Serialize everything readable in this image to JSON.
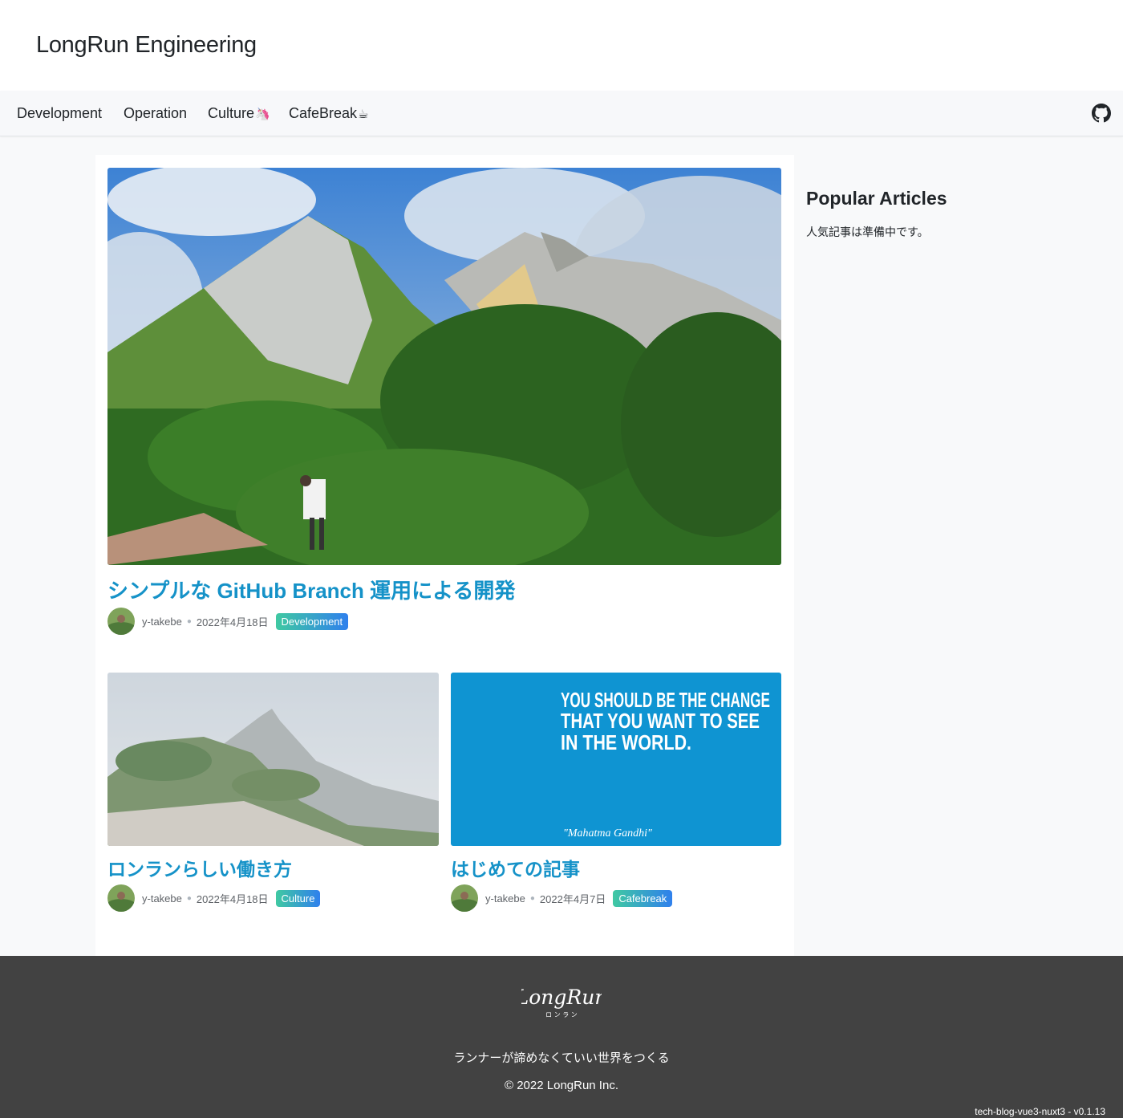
{
  "header": {
    "site_title": "LongRun Engineering"
  },
  "nav": {
    "items": [
      {
        "label": "Development",
        "emoji": ""
      },
      {
        "label": "Operation",
        "emoji": ""
      },
      {
        "label": "Culture",
        "emoji": "🦄"
      },
      {
        "label": "CafeBreak",
        "emoji": "☕"
      }
    ],
    "github_icon": "github-icon"
  },
  "posts": [
    {
      "title": "シンプルな GitHub Branch 運用による開発",
      "author": "y-takebe",
      "date": "2022年4月18日",
      "category": "Development",
      "image": "mountain-ridge-runner-photo"
    },
    {
      "title": "ロンランらしい働き方",
      "author": "y-takebe",
      "date": "2022年4月18日",
      "category": "Culture",
      "image": "misty-mountain-photo"
    },
    {
      "title": "はじめての記事",
      "author": "y-takebe",
      "date": "2022年4月7日",
      "category": "Cafebreak",
      "image": "quote-image"
    }
  ],
  "quote_image": {
    "lines": [
      "YOU SHOULD BE THE CHANGE",
      "THAT YOU WANT TO SEE",
      "IN THE WORLD."
    ],
    "attribution": "\"Mahatma Gandhi\""
  },
  "sidebar": {
    "heading": "Popular Articles",
    "empty_text": "人気記事は準備中です。"
  },
  "footer": {
    "logo_text": "LongRun",
    "logo_kana": "ロ ン ラ ン",
    "tagline": "ランナーが諦めなくていい世界をつくる",
    "copyright": "© 2022 LongRun Inc.",
    "version": "tech-blog-vue3-nuxt3 - v0.1.13"
  },
  "colors": {
    "link": "#1592c8",
    "badge_start": "#40c9a2",
    "badge_end": "#2f80ed",
    "footer_bg": "#424242",
    "quote_bg": "#0f94d2"
  }
}
